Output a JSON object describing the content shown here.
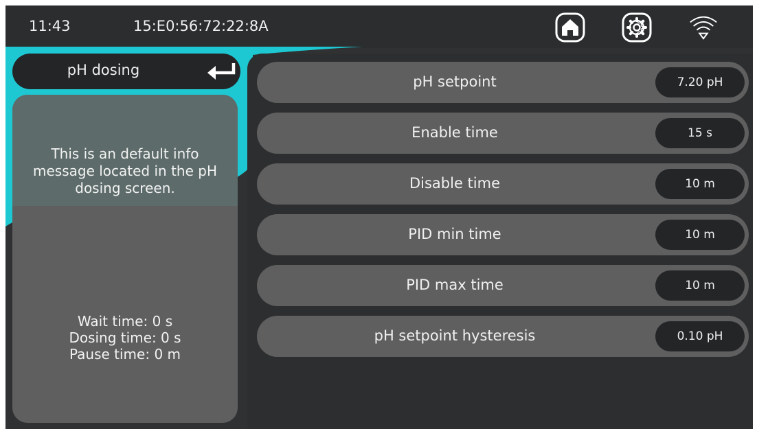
{
  "status_bar": {
    "time": "11:43",
    "device_id": "15:E0:56:72:22:8A"
  },
  "icons": {
    "home": "home-icon",
    "settings": "gear-icon",
    "wifi": "wifi-icon",
    "back": "return-arrow-icon"
  },
  "colors": {
    "accent": "#1ec8d2"
  },
  "left_panel": {
    "title": "pH dosing",
    "info_message": "This is an default info message located in the pH dosing screen.",
    "stats": {
      "wait_time": "Wait time: 0 s",
      "dosing_time": "Dosing time: 0 s",
      "pause_time": "Pause time: 0 m"
    }
  },
  "settings": [
    {
      "label": "pH setpoint",
      "value": "7.20 pH"
    },
    {
      "label": "Enable time",
      "value": "15 s"
    },
    {
      "label": "Disable time",
      "value": "10 m"
    },
    {
      "label": "PID min time",
      "value": "10 m"
    },
    {
      "label": "PID max time",
      "value": "10 m"
    },
    {
      "label": "pH setpoint hysteresis",
      "value": "0.10 pH"
    }
  ]
}
